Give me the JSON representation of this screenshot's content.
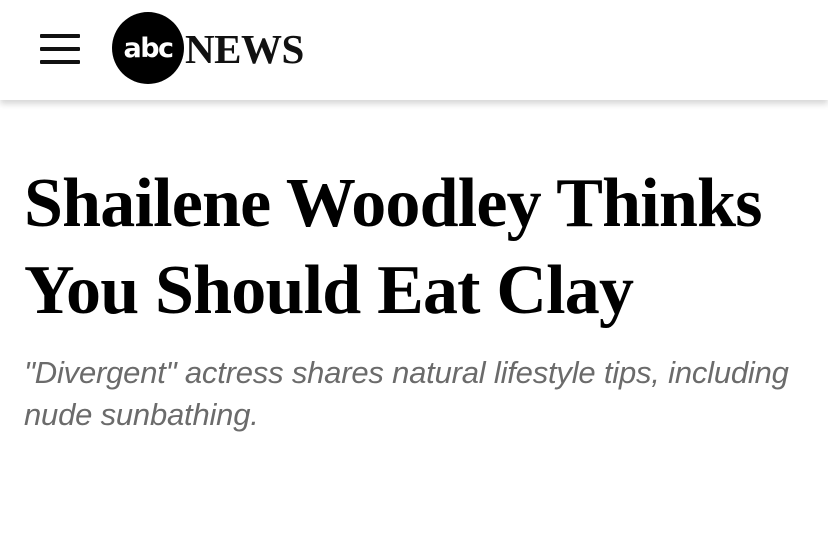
{
  "header": {
    "logo": {
      "circle_text": "abc",
      "wordmark": "NEWS"
    },
    "menu_icon": "hamburger-menu-icon"
  },
  "article": {
    "headline": "Shailene Woodley Thinks You Should Eat Clay",
    "subhead": "\"Divergent\" actress shares natural lifestyle tips, including nude sunbathing."
  },
  "colors": {
    "text_primary": "#000000",
    "text_secondary": "#6b6b6b",
    "logo_circle": "#000000",
    "background": "#ffffff"
  }
}
